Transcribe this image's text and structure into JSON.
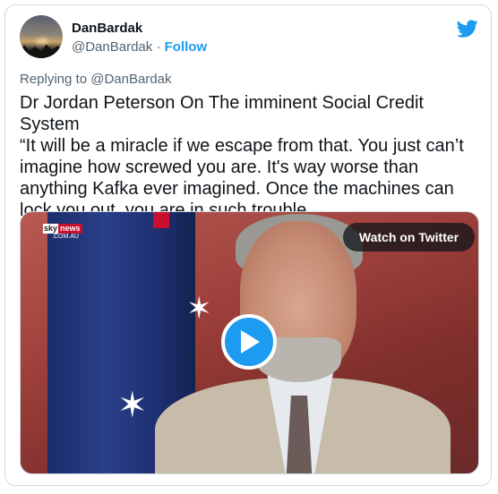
{
  "author": {
    "name": "DanBardak",
    "handle": "@DanBardak",
    "separator": "·",
    "follow_label": "Follow"
  },
  "brand": {
    "icon": "twitter-bird-icon",
    "color": "#1d9bf0"
  },
  "reply": {
    "label": "Replying to @DanBardak"
  },
  "tweet": {
    "line1": "Dr Jordan Peterson On The imminent Social Credit System",
    "line2": "“It will be a miracle if we escape from that. You just can’t imagine how screwed you are. It's way worse than anything Kafka ever imagined. Once the machines can lock you out, you are in such trouble..."
  },
  "media": {
    "watch_label": "Watch on Twitter",
    "play_icon": "play-icon",
    "logo": {
      "word": "sky",
      "brand": "news",
      "domain": ".COM.AU"
    }
  }
}
